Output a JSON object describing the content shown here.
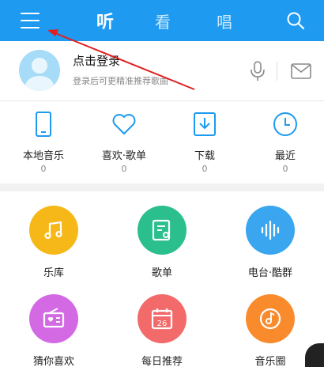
{
  "header": {
    "tabs": [
      {
        "label": "听",
        "active": true
      },
      {
        "label": "看",
        "active": false
      },
      {
        "label": "唱",
        "active": false
      }
    ],
    "accent": "#1e9af0",
    "icons": [
      "menu-icon",
      "search-icon"
    ]
  },
  "profile": {
    "title": "点击登录",
    "subtitle": "登录后可更精准推荐歌曲",
    "icons": [
      "avatar",
      "microphone-icon",
      "mail-icon"
    ]
  },
  "quick_links": [
    {
      "label": "本地音乐",
      "count": "0",
      "icon": "phone-icon"
    },
    {
      "label": "喜欢·歌单",
      "count": "0",
      "icon": "heart-icon"
    },
    {
      "label": "下载",
      "count": "0",
      "icon": "download-icon"
    },
    {
      "label": "最近",
      "count": "0",
      "icon": "clock-icon"
    }
  ],
  "grid": [
    {
      "label": "乐库",
      "color": "#f5b818",
      "icon": "music-note-icon"
    },
    {
      "label": "歌单",
      "color": "#2bbf8d",
      "icon": "playlist-icon"
    },
    {
      "label": "电台·酷群",
      "color": "#3aa6f0",
      "icon": "radio-wave-icon"
    },
    {
      "label": "猜你喜欢",
      "color": "#d36ae4",
      "icon": "radio-heart-icon"
    },
    {
      "label": "每日推荐",
      "color": "#f26a6a",
      "icon": "calendar-icon",
      "badge": "26"
    },
    {
      "label": "音乐圈",
      "color": "#fa8b2d",
      "icon": "music-disc-icon"
    }
  ],
  "annotation": {
    "color": "#e02020"
  }
}
